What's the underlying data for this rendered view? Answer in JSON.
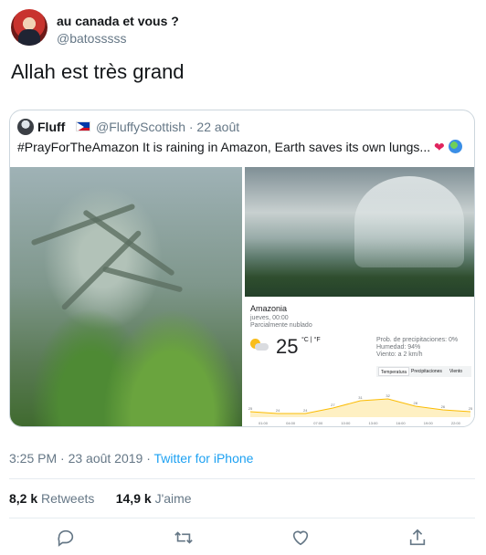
{
  "tweet": {
    "display_name": "au canada et vous ?",
    "handle": "@batosssss",
    "text": "Allah est très grand"
  },
  "quoted": {
    "display_name": "Fluff",
    "handle_date": "@FluffyScottish · 22 août",
    "text": "#PrayForTheAmazon It is raining in Amazon, Earth saves its own lungs...",
    "emoji_heart": "❤",
    "weather": {
      "location": "Amazonia",
      "date": "jueves, 00:00",
      "condition": "Parcialmente nublado",
      "temp": "25",
      "units": "°C | °F",
      "precip": "Prob. de precipitaciones: 0%",
      "humidity": "Humedad: 94%",
      "wind": "Viento: a 2 km/h",
      "tabs": [
        "Temperatura",
        "Precipitaciones",
        "Viento"
      ],
      "chart_temps": [
        25,
        24,
        24,
        27,
        31,
        32,
        28,
        26,
        25
      ],
      "chart_times": [
        "01:00",
        "04:00",
        "07:00",
        "10:00",
        "13:00",
        "16:00",
        "19:00",
        "22:00"
      ]
    }
  },
  "meta": {
    "time": "3:25 PM · 23 août 2019 · ",
    "source": "Twitter for iPhone"
  },
  "stats": {
    "retweets_count": "8,2 k",
    "retweets_label": "Retweets",
    "likes_count": "14,9 k",
    "likes_label": "J'aime"
  },
  "icons": [
    "reply-icon",
    "retweet-icon",
    "like-icon",
    "share-icon"
  ]
}
